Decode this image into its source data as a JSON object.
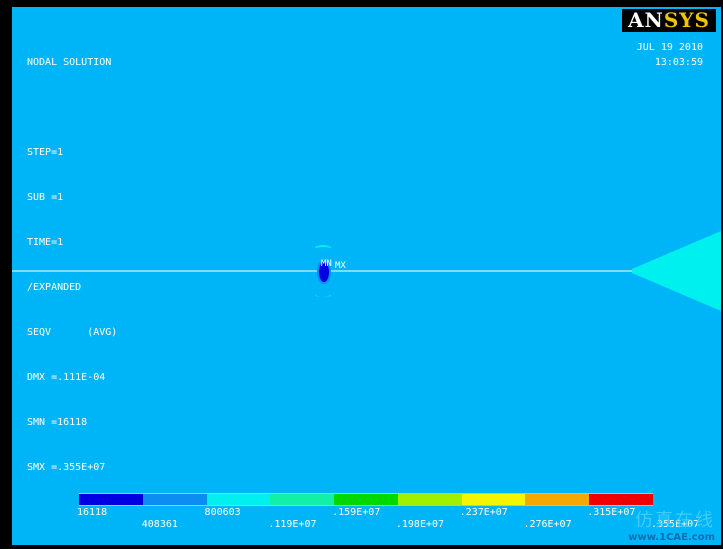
{
  "info": {
    "lines": [
      "NODAL SOLUTION",
      "",
      "STEP=1",
      "SUB =1",
      "TIME=1",
      "/EXPANDED",
      "SEQV      (AVG)",
      "DMX =.111E-04",
      "SMN =16118",
      "SMX =.355E+07"
    ]
  },
  "date": {
    "day": "JUL 19 2010",
    "time": "13:03:59"
  },
  "logo": {
    "text_a": "AN",
    "text_b": "SYS"
  },
  "markers": {
    "mn": "MN",
    "mx": "MX"
  },
  "legend": {
    "colors": [
      "#0000e0",
      "#0b8ef0",
      "#00f0f0",
      "#12f0a8",
      "#00d800",
      "#a0f000",
      "#f5f500",
      "#f5a800",
      "#f00000"
    ],
    "labels_top": [
      "16118",
      "800603",
      ".159E+07",
      ".237E+07",
      ".315E+07"
    ],
    "labels_bottom": [
      "408361",
      ".119E+07",
      ".198E+07",
      ".276E+07",
      ".355E+07"
    ]
  },
  "watermark": {
    "cn": "仿真在线",
    "url": "www.1CAE.com"
  }
}
